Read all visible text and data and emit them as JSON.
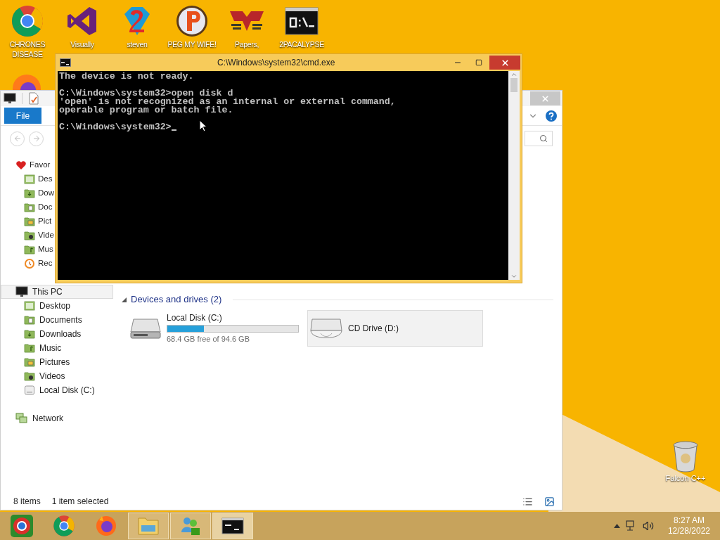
{
  "desktop_icons": [
    {
      "kind": "chrome",
      "label": "CHRONES DISEASE"
    },
    {
      "kind": "studio",
      "label": "Visually"
    },
    {
      "kind": "gem",
      "label": "steven"
    },
    {
      "kind": "ball",
      "label": "PEG MY WIFE!"
    },
    {
      "kind": "eagle",
      "label": "Papers,"
    },
    {
      "kind": "console",
      "label": "2PACALYPSE"
    }
  ],
  "hidden_icon": {
    "kind": "firefox"
  },
  "recycle_bin": {
    "label": "Falcon C++"
  },
  "explorer": {
    "ribbon_tab": "File",
    "favorites": {
      "label": "Favor",
      "items": [
        {
          "kind": "desktop",
          "label": "Des"
        },
        {
          "kind": "downloads",
          "label": "Dow"
        },
        {
          "kind": "documents",
          "label": "Doc"
        },
        {
          "kind": "pictures",
          "label": "Pict"
        },
        {
          "kind": "videos",
          "label": "Vide"
        },
        {
          "kind": "music",
          "label": "Mus"
        },
        {
          "kind": "recent",
          "label": "Rec"
        }
      ]
    },
    "this_pc": {
      "label": "This PC",
      "selected": true,
      "items": [
        {
          "kind": "desktop",
          "label": "Desktop"
        },
        {
          "kind": "documents",
          "label": "Documents"
        },
        {
          "kind": "downloads",
          "label": "Downloads"
        },
        {
          "kind": "music",
          "label": "Music"
        },
        {
          "kind": "pictures",
          "label": "Pictures"
        },
        {
          "kind": "videos",
          "label": "Videos"
        },
        {
          "kind": "disk",
          "label": "Local Disk (C:)"
        }
      ]
    },
    "network": {
      "label": "Network"
    },
    "section": {
      "title": "Devices and drives (2)",
      "expanded": true
    },
    "drives": [
      {
        "kind": "disk",
        "name": "Local Disk (C:)",
        "level": 0.28,
        "free": "68.4 GB free of 94.6 GB",
        "selected": false
      },
      {
        "kind": "cd",
        "name": "CD Drive (D:)",
        "selected": true
      }
    ],
    "status": {
      "count": "8 items",
      "selection": "1 item selected"
    }
  },
  "cmd": {
    "title": "C:\\Windows\\system32\\cmd.exe",
    "cursor": true,
    "blocks": [
      [
        "The device is not ready."
      ],
      [
        "C:\\Windows\\system32>open disk d",
        "'open' is not recognized as an internal or external command,",
        "operable program or batch file."
      ],
      [
        "C:\\Windows\\system32>"
      ]
    ]
  },
  "taskbar": {
    "apps": [
      {
        "kind": "chrome-alt",
        "running": false,
        "selected": false
      },
      {
        "kind": "chrome",
        "running": false,
        "selected": false
      },
      {
        "kind": "firefox",
        "running": false,
        "selected": false
      },
      {
        "kind": "explorer",
        "running": true,
        "selected": false
      },
      {
        "kind": "people",
        "running": true,
        "selected": false
      },
      {
        "kind": "console",
        "running": true,
        "selected": true
      }
    ],
    "clock": {
      "time": "8:27 AM",
      "date": "12/28/2022"
    }
  }
}
